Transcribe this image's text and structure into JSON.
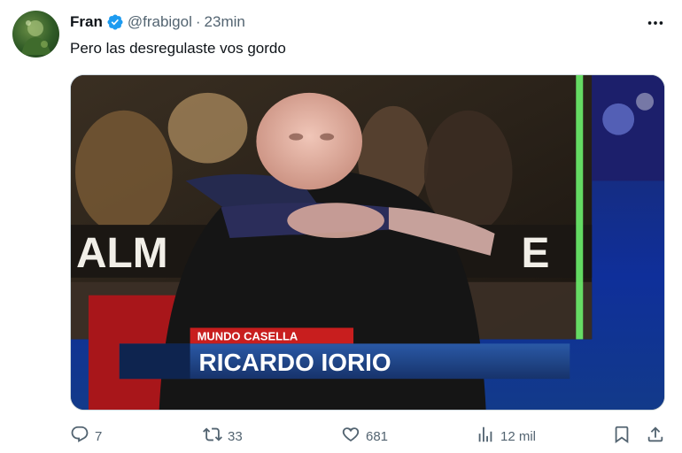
{
  "author": {
    "name": "Fran",
    "handle": "@frabigol",
    "separator": "·",
    "time": "23min",
    "verified": true
  },
  "tweet": {
    "text": "Pero las desregulaste vos gordo"
  },
  "media": {
    "lower_third_tag": "MUNDO CASELLA",
    "lower_third_name": "RICARDO IORIO",
    "poster_text_left": "ALM",
    "poster_text_right": "E"
  },
  "actions": {
    "replies": "7",
    "retweets": "33",
    "likes": "681",
    "views": "12 mil"
  },
  "colors": {
    "accent": "#1d9bf0",
    "muted": "#536471",
    "text": "#0f1419"
  },
  "icons": [
    "more-icon",
    "verified-badge-icon",
    "reply-icon",
    "retweet-icon",
    "like-icon",
    "views-icon",
    "bookmark-icon",
    "share-icon"
  ]
}
